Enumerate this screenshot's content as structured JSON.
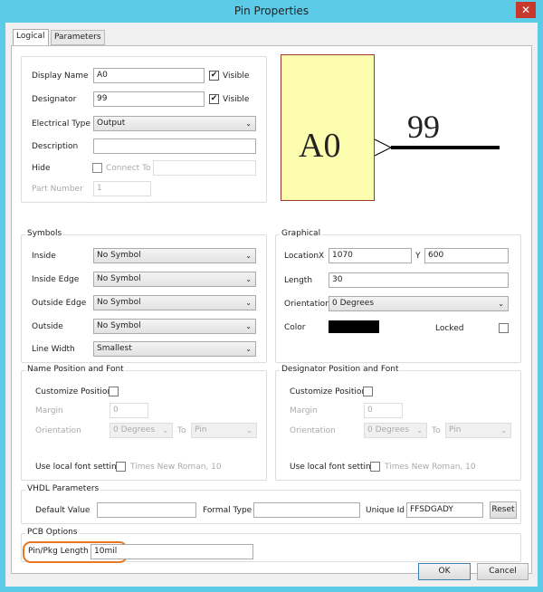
{
  "window": {
    "title": "Pin Properties",
    "close": "✕"
  },
  "tabs": [
    "Logical",
    "Parameters"
  ],
  "logical": {
    "display_name_label": "Display Name",
    "display_name": "A0",
    "visible": "Visible",
    "designator_label": "Designator",
    "designator": "99",
    "electrical_type_label": "Electrical Type",
    "electrical_type": "Output",
    "description_label": "Description",
    "description": "",
    "hide_label": "Hide",
    "connect_to_label": "Connect To",
    "part_number_label": "Part Number",
    "part_number": "1"
  },
  "preview": {
    "name": "A0",
    "designator": "99"
  },
  "symbols": {
    "title": "Symbols",
    "rows": [
      {
        "label": "Inside",
        "value": "No Symbol"
      },
      {
        "label": "Inside Edge",
        "value": "No Symbol"
      },
      {
        "label": "Outside Edge",
        "value": "No Symbol"
      },
      {
        "label": "Outside",
        "value": "No Symbol"
      },
      {
        "label": "Line Width",
        "value": "Smallest"
      }
    ]
  },
  "graphical": {
    "title": "Graphical",
    "location_label": "Location",
    "x_label": "X",
    "x": "1070",
    "y_label": "Y",
    "y": "600",
    "length_label": "Length",
    "length": "30",
    "orientation_label": "Orientation",
    "orientation": "0 Degrees",
    "color_label": "Color",
    "color": "#000000",
    "locked_label": "Locked"
  },
  "name_pos": {
    "title": "Name Position and Font",
    "customize": "Customize Position",
    "margin_label": "Margin",
    "margin": "0",
    "orientation_label": "Orientation",
    "orientation": "0 Degrees",
    "to_label": "To",
    "to": "Pin",
    "font_label": "Use local font setting",
    "font": "Times New Roman, 10"
  },
  "des_pos": {
    "title": "Designator Position and Font",
    "customize": "Customize Position",
    "margin_label": "Margin",
    "margin": "0",
    "orientation_label": "Orientation",
    "orientation": "0 Degrees",
    "to_label": "To",
    "to": "Pin",
    "font_label": "Use local font setting",
    "font": "Times New Roman, 10"
  },
  "vhdl": {
    "title": "VHDL Parameters",
    "default_label": "Default Value",
    "formal_label": "Formal Type",
    "unique_label": "Unique Id",
    "unique": "FFSDGADY",
    "reset": "Reset"
  },
  "pcb": {
    "title": "PCB Options",
    "pin_pkg_label": "Pin/Pkg Length",
    "pin_pkg": "10mil"
  },
  "buttons": {
    "ok": "OK",
    "cancel": "Cancel"
  }
}
